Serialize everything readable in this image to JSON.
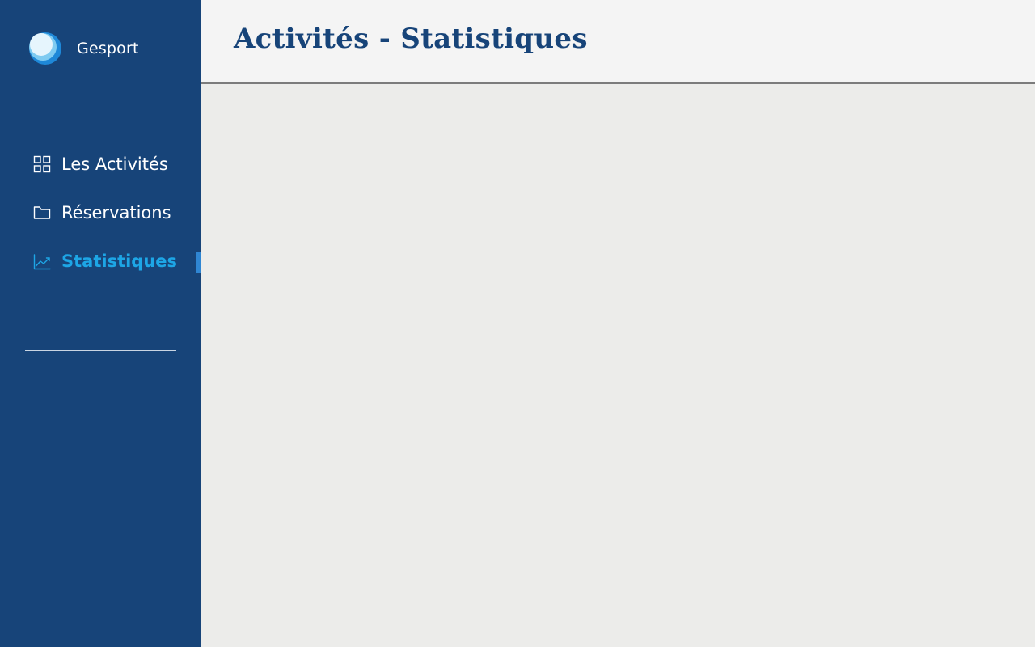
{
  "app": {
    "name": "Gesport"
  },
  "sidebar": {
    "items": [
      {
        "label": "Les Activités",
        "icon": "grid-icon",
        "active": false
      },
      {
        "label": "Réservations",
        "icon": "folder-icon",
        "active": false
      },
      {
        "label": "Statistiques",
        "icon": "chart-line-icon",
        "active": true
      }
    ]
  },
  "header": {
    "title": "Activités - Statistiques"
  },
  "colors": {
    "sidebar_bg": "#174479",
    "accent": "#1DA6E6",
    "title": "#174479",
    "header_bg": "#F4F4F4",
    "main_bg": "#ECECEA"
  }
}
